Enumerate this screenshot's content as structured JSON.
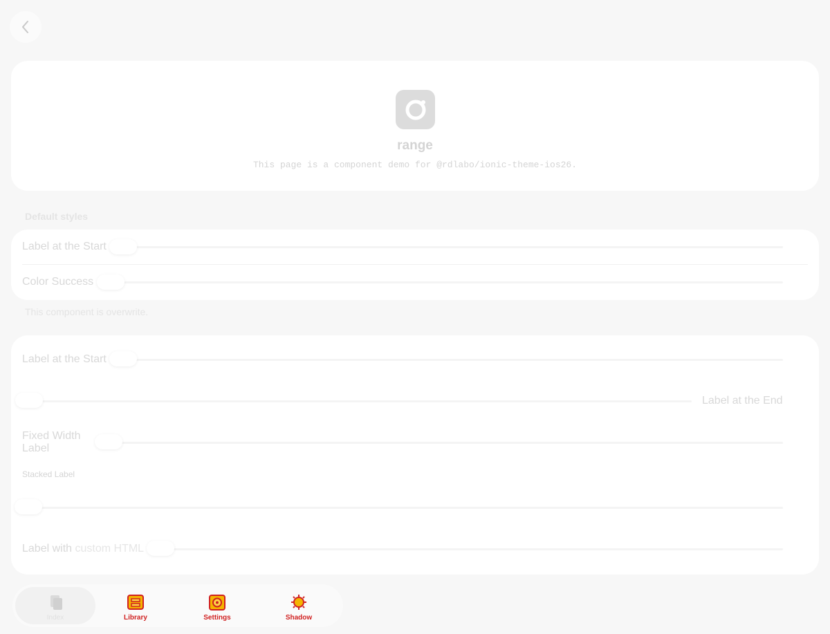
{
  "page": {
    "title": "range",
    "description": "This page is a component demo for @rdlabo/ionic-theme-ios26."
  },
  "sections": {
    "default_header": "Default styles",
    "default_rows": [
      {
        "label": "Label at the Start",
        "value": 0
      },
      {
        "label": "Color Success",
        "value": 0
      }
    ],
    "note": "This component is overwrite.",
    "custom_rows": {
      "label_start": "Label at the Start",
      "label_end": "Label at the End",
      "fixed_width": "Fixed Width Label",
      "stacked": "Stacked Label",
      "custom_html_plain": "Label with",
      "custom_html_accent": "custom HTML"
    }
  },
  "tabbar": {
    "tabs": [
      {
        "label": "Index",
        "icon": "documents-icon",
        "active": true
      },
      {
        "label": "Library",
        "icon": "library-icon",
        "active": false
      },
      {
        "label": "Settings",
        "icon": "settings-icon",
        "active": false
      },
      {
        "label": "Shadow",
        "icon": "shadow-icon",
        "active": false
      }
    ]
  },
  "colors": {
    "background": "#f7f7f7",
    "card": "#ffffff",
    "tab_icon_fill": "#e8a800",
    "tab_icon_stroke": "#d02020"
  }
}
